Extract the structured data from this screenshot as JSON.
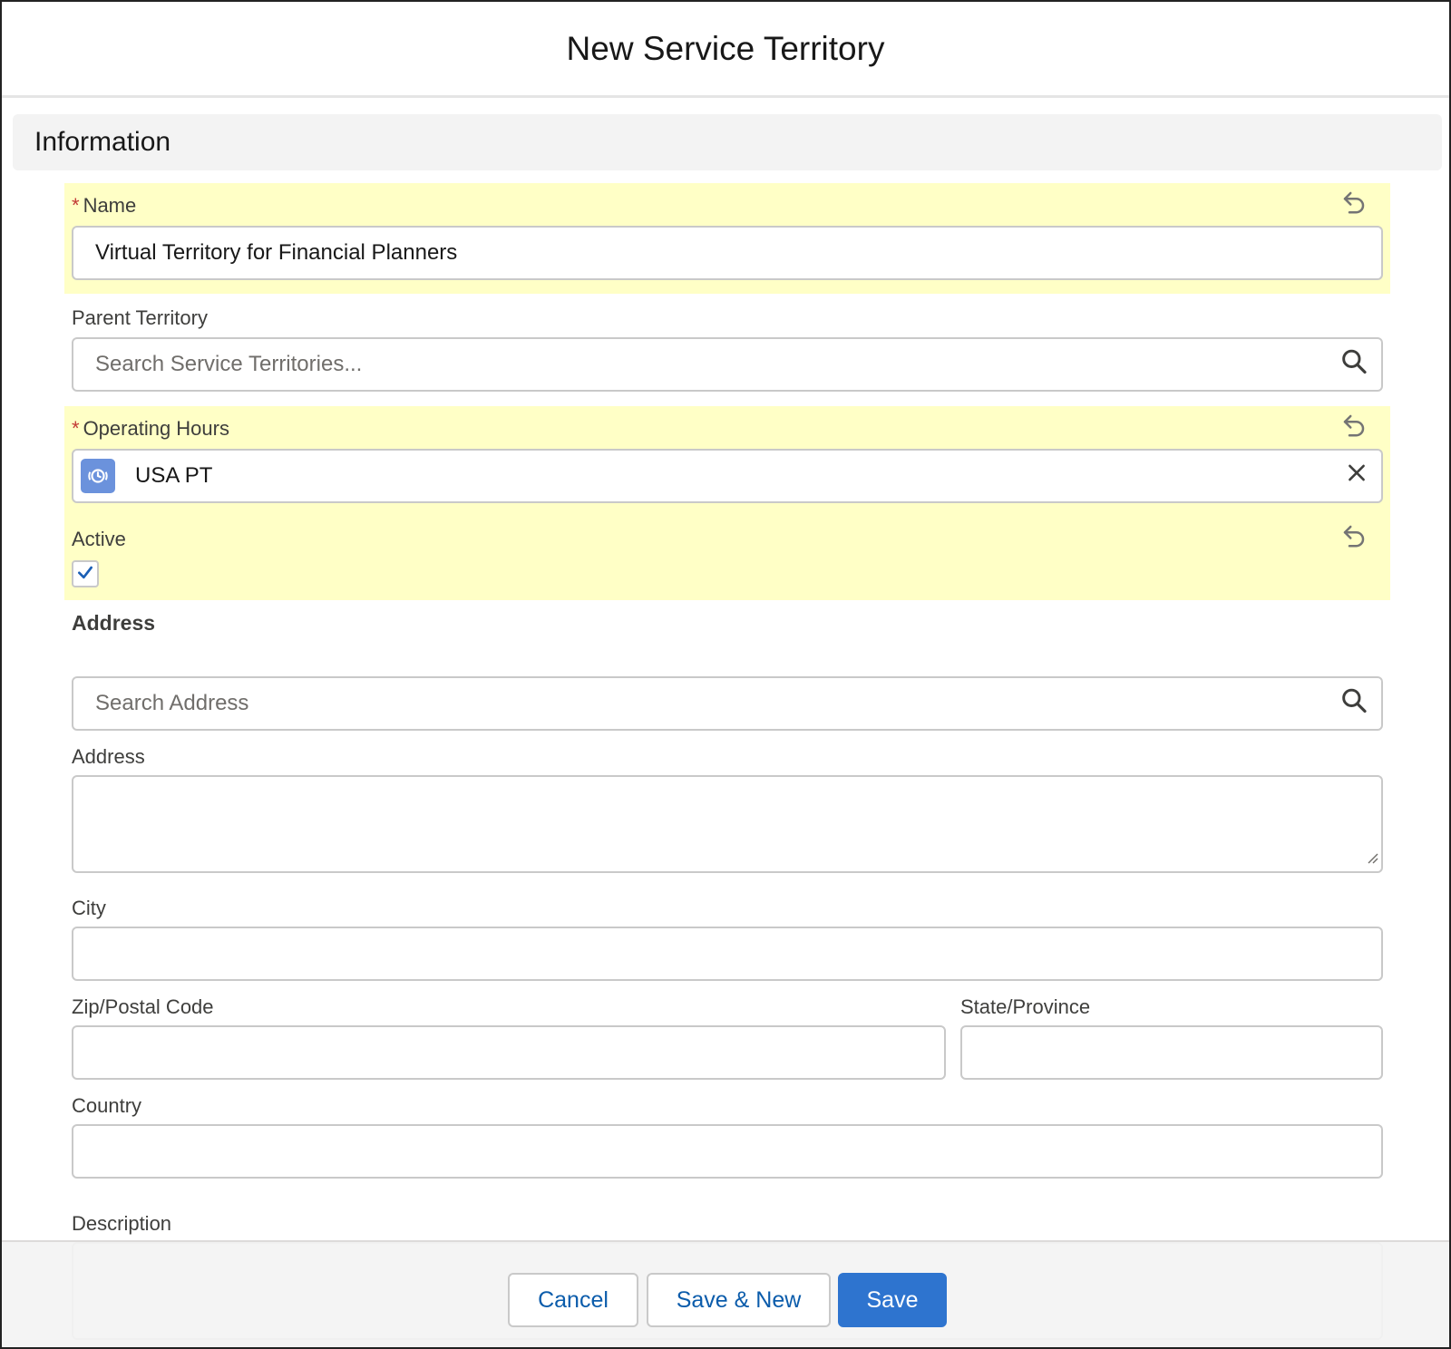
{
  "modal": {
    "title": "New Service Territory"
  },
  "section": {
    "title": "Information"
  },
  "fields": {
    "name": {
      "label": "Name",
      "required_mark": "*",
      "value": "Virtual Territory for Financial Planners"
    },
    "parent_territory": {
      "label": "Parent Territory",
      "placeholder": "Search Service Territories..."
    },
    "operating_hours": {
      "label": "Operating Hours",
      "required_mark": "*",
      "value": "USA PT"
    },
    "active": {
      "label": "Active",
      "checked": true
    },
    "address_group": {
      "label": "Address"
    },
    "search_address": {
      "placeholder": "Search Address"
    },
    "address": {
      "label": "Address",
      "value": ""
    },
    "city": {
      "label": "City",
      "value": ""
    },
    "zip": {
      "label": "Zip/Postal Code",
      "value": ""
    },
    "state": {
      "label": "State/Province",
      "value": ""
    },
    "country": {
      "label": "Country",
      "value": ""
    },
    "description": {
      "label": "Description",
      "value": ""
    }
  },
  "footer": {
    "cancel_label": "Cancel",
    "save_new_label": "Save & New",
    "save_label": "Save"
  },
  "icons": {
    "undo": "undo-icon",
    "search": "search-icon",
    "clear": "close-icon",
    "lookup": "operating-hours-icon",
    "check": "checkmark-icon"
  },
  "colors": {
    "brand": "#2e74cf",
    "highlight": "#ffffc6",
    "required": "#c23934",
    "link": "#0b5cab",
    "lookup_badge": "#6b92dc"
  }
}
